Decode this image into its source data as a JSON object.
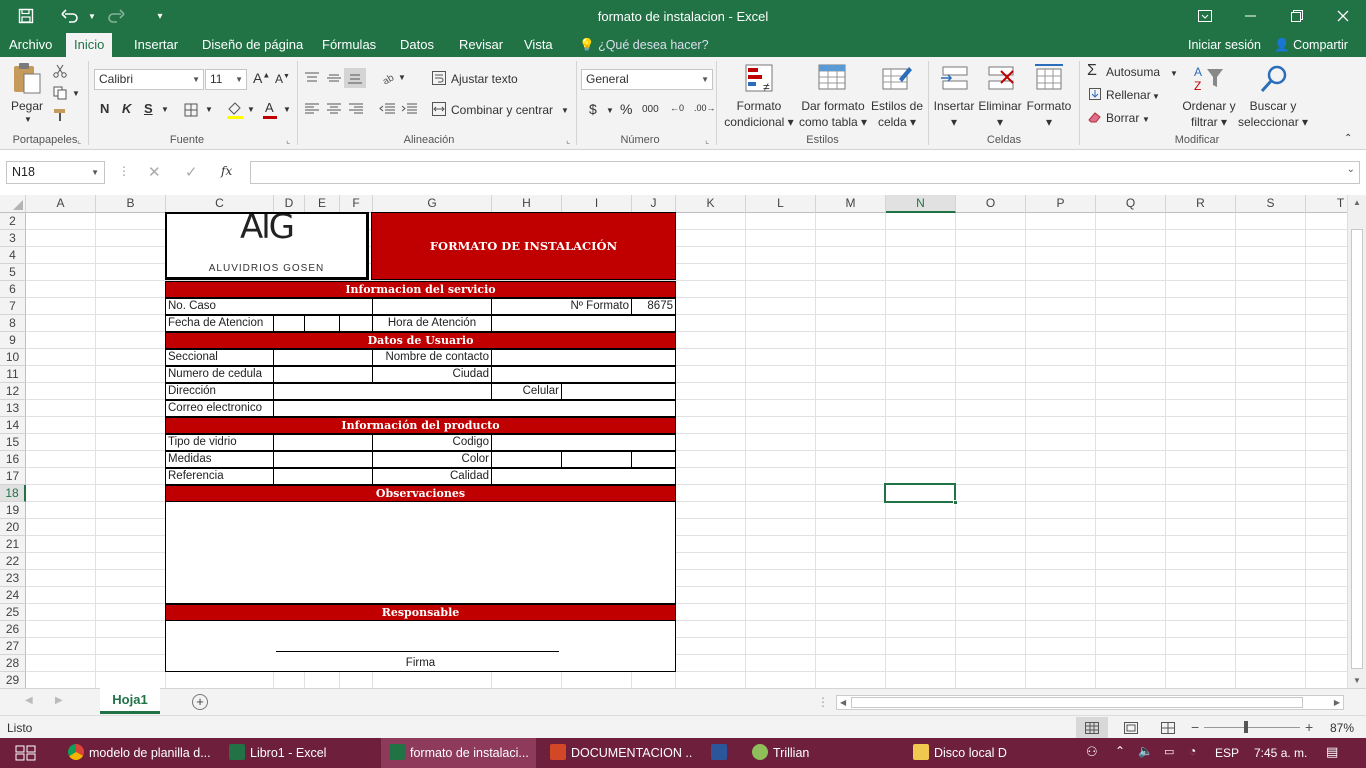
{
  "window": {
    "title": "formato de instalacion - Excel"
  },
  "tabs": [
    "Archivo",
    "Inicio",
    "Insertar",
    "Diseño de página",
    "Fórmulas",
    "Datos",
    "Revisar",
    "Vista"
  ],
  "tell_me": "¿Qué desea hacer?",
  "signin": "Iniciar sesión",
  "share": "Compartir",
  "ribbon": {
    "paste": "Pegar",
    "font_name": "Calibri",
    "font_size": "11",
    "bold": "N",
    "italic": "K",
    "underline": "S",
    "wrap_text": "Ajustar texto",
    "merge_center": "Combinar y centrar",
    "number_format": "General",
    "currency": "$",
    "percent": "%",
    "thousands": "000",
    "cond_format": [
      "Formato",
      "condicional"
    ],
    "table_format": [
      "Dar formato",
      "como tabla"
    ],
    "cell_styles": [
      "Estilos de",
      "celda"
    ],
    "insert": "Insertar",
    "delete": "Eliminar",
    "format": "Formato",
    "autosum": "Autosuma",
    "fill": "Rellenar",
    "clear": "Borrar",
    "sort": [
      "Ordenar y",
      "filtrar"
    ],
    "find": [
      "Buscar y",
      "seleccionar"
    ],
    "groups": [
      "Portapapeles",
      "Fuente",
      "Alineación",
      "Número",
      "Estilos",
      "Celdas",
      "Modificar"
    ]
  },
  "formula_bar": {
    "name_box": "N18",
    "fx": "fx",
    "value": ""
  },
  "columns": [
    "A",
    "B",
    "C",
    "D",
    "E",
    "F",
    "G",
    "H",
    "I",
    "J",
    "K",
    "L",
    "M",
    "N",
    "O",
    "P",
    "Q",
    "R",
    "S",
    "T"
  ],
  "rows": [
    "2",
    "3",
    "4",
    "5",
    "6",
    "7",
    "8",
    "9",
    "10",
    "11",
    "12",
    "13",
    "14",
    "15",
    "16",
    "17",
    "18",
    "19",
    "20",
    "21",
    "22",
    "23",
    "24",
    "25",
    "26",
    "27",
    "28",
    "29"
  ],
  "form": {
    "logo_text": "AlG",
    "logo_subtitle": "ALUVIDRIOS GOSEN",
    "title": "FORMATO DE INSTALACIÓN",
    "section_service": "Informacion del servicio",
    "no_caso": "No. Caso",
    "n_formato": "Nº Formato",
    "formato_value": "8675",
    "fecha": "Fecha de Atencion",
    "hora": "Hora de Atención",
    "section_user": "Datos de Usuario",
    "seccional": "Seccional",
    "nombre_contacto": "Nombre de contacto",
    "cedula": "Numero de cedula",
    "ciudad": "Ciudad",
    "direccion": "Dirección",
    "celular": "Celular",
    "correo": "Correo electronico",
    "section_product": "Información del producto",
    "tipo_vidrio": "Tipo de vidrio",
    "codigo": "Codigo",
    "medidas": "Medidas",
    "color": "Color",
    "referencia": "Referencia",
    "calidad": "Calidad",
    "section_obs": "Observaciones",
    "section_resp": "Responsable",
    "firma": "Firma"
  },
  "sheet_tab": "Hoja1",
  "status": {
    "ready": "Listo",
    "zoom": "87%"
  },
  "taskbar": {
    "items": [
      "modelo de planilla d...",
      "Libro1 - Excel",
      "formato de instalaci...",
      "DOCUMENTACION ...",
      "Trillian",
      "Disco local D"
    ],
    "lang": "ESP",
    "time": "7:45 a. m."
  },
  "colors": {
    "excel_green": "#217346",
    "form_red": "#c00000",
    "taskbar": "#6e1f3c"
  }
}
